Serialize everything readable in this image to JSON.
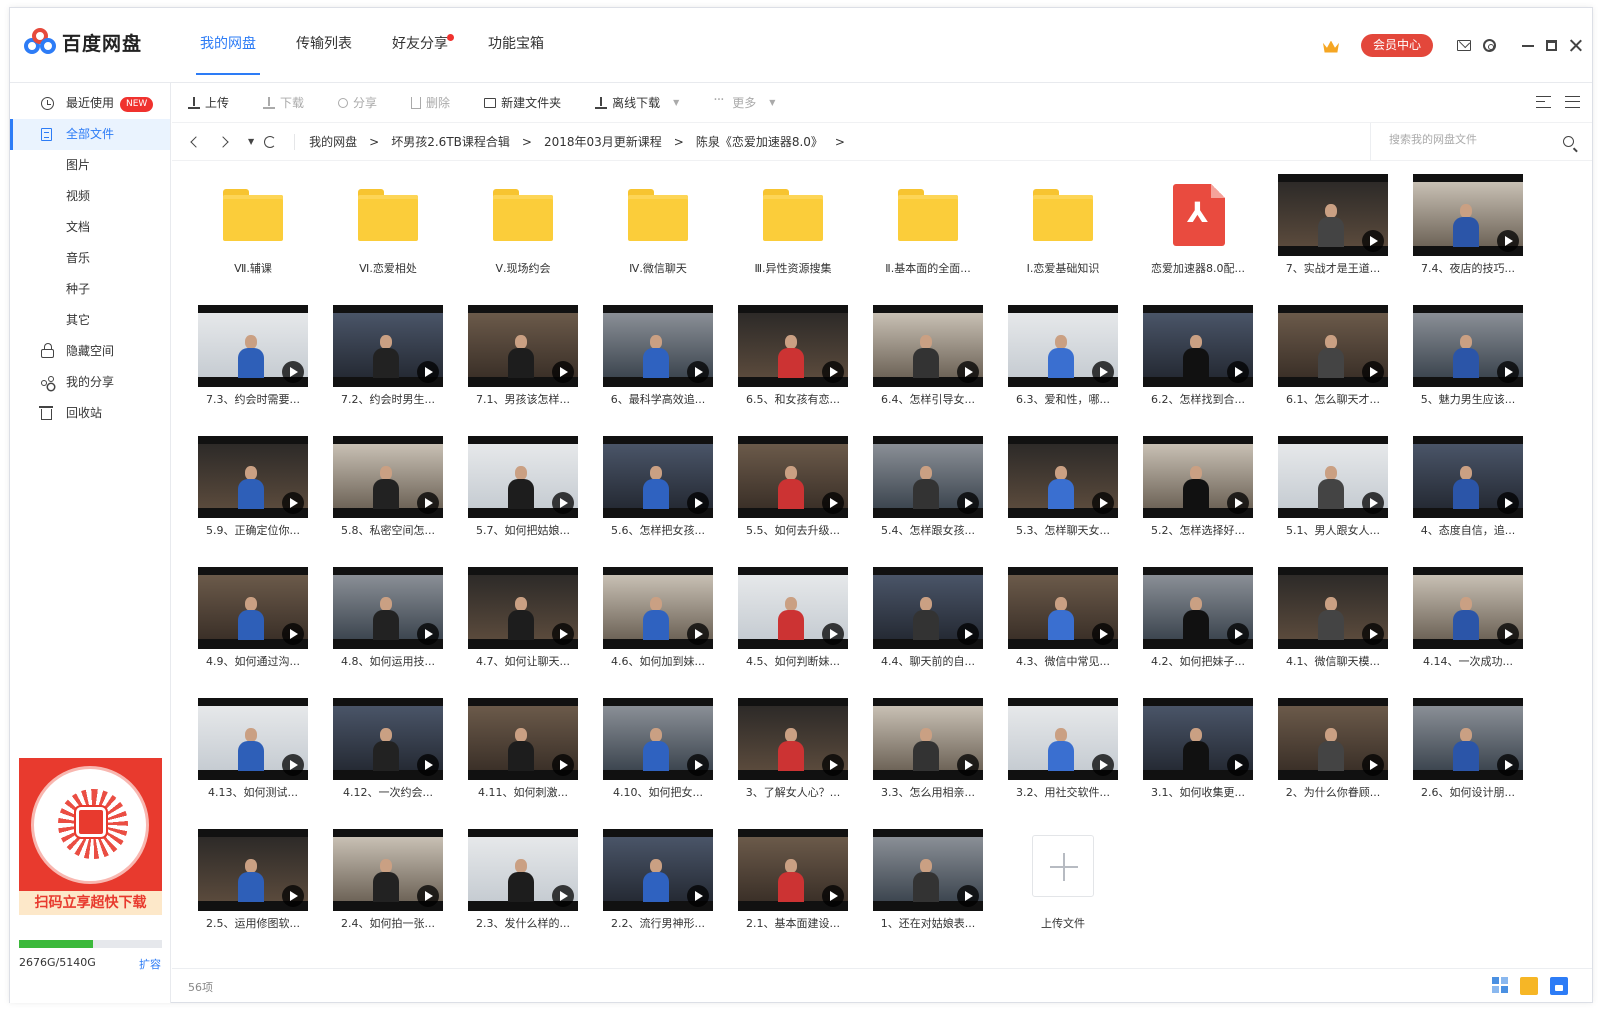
{
  "app": {
    "name": "百度网盘",
    "vip_label": "会员中心"
  },
  "main_tabs": [
    {
      "label": "我的网盘",
      "active": true
    },
    {
      "label": "传输列表",
      "active": false
    },
    {
      "label": "好友分享",
      "active": false,
      "dot": true
    },
    {
      "label": "功能宝箱",
      "active": false
    }
  ],
  "sidebar": {
    "items": [
      {
        "label": "最近使用",
        "icon": "clock-icon",
        "badge": "NEW"
      },
      {
        "label": "全部文件",
        "icon": "file-icon",
        "active": true
      },
      {
        "label": "图片"
      },
      {
        "label": "视频"
      },
      {
        "label": "文档"
      },
      {
        "label": "音乐"
      },
      {
        "label": "种子"
      },
      {
        "label": "其它"
      },
      {
        "label": "隐藏空间",
        "icon": "lock-icon"
      },
      {
        "label": "我的分享",
        "icon": "share-icon"
      },
      {
        "label": "回收站",
        "icon": "trash-icon"
      }
    ],
    "promo_text": "扫码立享超快下载",
    "storage_text": "2676G/5140G",
    "storage_used_fraction": 0.52,
    "expand_label": "扩容"
  },
  "toolbar": {
    "upload": "上传",
    "download": "下载",
    "share": "分享",
    "delete": "删除",
    "new_folder": "新建文件夹",
    "offline_download": "离线下载",
    "more": "更多"
  },
  "breadcrumb": [
    "我的网盘",
    "坏男孩2.6TB课程合辑",
    "2018年03月更新课程",
    "陈泉《恋爱加速器8.0》"
  ],
  "search": {
    "placeholder": "搜索我的网盘文件"
  },
  "files": [
    {
      "name": "Ⅶ.辅课",
      "type": "folder"
    },
    {
      "name": "Ⅵ.恋爱相处",
      "type": "folder"
    },
    {
      "name": "Ⅴ.现场约会",
      "type": "folder"
    },
    {
      "name": "Ⅳ.微信聊天",
      "type": "folder"
    },
    {
      "name": "Ⅲ.异性资源搜集",
      "type": "folder"
    },
    {
      "name": "Ⅱ.基本面的全面...",
      "type": "folder"
    },
    {
      "name": "Ⅰ.恋爱基础知识",
      "type": "folder"
    },
    {
      "name": "恋爱加速器8.0配...",
      "type": "pdf"
    },
    {
      "name": "7、实战才是王道...",
      "type": "video"
    },
    {
      "name": "7.4、夜店的技巧...",
      "type": "video"
    },
    {
      "name": "7.3、约会时需要...",
      "type": "video"
    },
    {
      "name": "7.2、约会时男生...",
      "type": "video"
    },
    {
      "name": "7.1、男孩该怎样...",
      "type": "video"
    },
    {
      "name": "6、最科学高效追...",
      "type": "video"
    },
    {
      "name": "6.5、和女孩有恋...",
      "type": "video"
    },
    {
      "name": "6.4、怎样引导女...",
      "type": "video"
    },
    {
      "name": "6.3、爱和性，哪...",
      "type": "video"
    },
    {
      "name": "6.2、怎样找到合...",
      "type": "video"
    },
    {
      "name": "6.1、怎么聊天才...",
      "type": "video"
    },
    {
      "name": "5、魅力男生应该...",
      "type": "video"
    },
    {
      "name": "5.9、正确定位你...",
      "type": "video"
    },
    {
      "name": "5.8、私密空间怎...",
      "type": "video"
    },
    {
      "name": "5.7、如何把姑娘...",
      "type": "video"
    },
    {
      "name": "5.6、怎样把女孩...",
      "type": "video"
    },
    {
      "name": "5.5、如何去升级...",
      "type": "video"
    },
    {
      "name": "5.4、怎样跟女孩...",
      "type": "video"
    },
    {
      "name": "5.3、怎样聊天女...",
      "type": "video"
    },
    {
      "name": "5.2、怎样选择好...",
      "type": "video"
    },
    {
      "name": "5.1、男人跟女人...",
      "type": "video"
    },
    {
      "name": "4、态度自信，追...",
      "type": "video"
    },
    {
      "name": "4.9、如何通过沟...",
      "type": "video"
    },
    {
      "name": "4.8、如何运用技...",
      "type": "video"
    },
    {
      "name": "4.7、如何让聊天...",
      "type": "video"
    },
    {
      "name": "4.6、如何加到妹...",
      "type": "video"
    },
    {
      "name": "4.5、如何判断妹...",
      "type": "video"
    },
    {
      "name": "4.4、聊天前的自...",
      "type": "video"
    },
    {
      "name": "4.3、微信中常见...",
      "type": "video"
    },
    {
      "name": "4.2、如何把妹子...",
      "type": "video"
    },
    {
      "name": "4.1、微信聊天模...",
      "type": "video"
    },
    {
      "name": "4.14、一次成功...",
      "type": "video"
    },
    {
      "name": "4.13、如何测试...",
      "type": "video"
    },
    {
      "name": "4.12、一次约会...",
      "type": "video"
    },
    {
      "name": "4.11、如何刺激...",
      "type": "video"
    },
    {
      "name": "4.10、如何把女...",
      "type": "video"
    },
    {
      "name": "3、了解女人心？...",
      "type": "video"
    },
    {
      "name": "3.3、怎么用相亲...",
      "type": "video"
    },
    {
      "name": "3.2、用社交软件...",
      "type": "video"
    },
    {
      "name": "3.1、如何收集更...",
      "type": "video"
    },
    {
      "name": "2、为什么你眷顾...",
      "type": "video"
    },
    {
      "name": "2.6、如何设计朋...",
      "type": "video"
    },
    {
      "name": "2.5、运用修图软...",
      "type": "video"
    },
    {
      "name": "2.4、如何拍一张...",
      "type": "video"
    },
    {
      "name": "2.3、发什么样的...",
      "type": "video"
    },
    {
      "name": "2.2、流行男神形...",
      "type": "video"
    },
    {
      "name": "2.1、基本面建设...",
      "type": "video"
    },
    {
      "name": "1、还在对姑娘表...",
      "type": "video"
    }
  ],
  "upload_tile_label": "上传文件",
  "status": {
    "count": "56项"
  },
  "colors": {
    "accent": "#2d7cf6",
    "folder": "#fbcd3a",
    "vip": "#e3473b",
    "pdf": "#e94b3f"
  }
}
